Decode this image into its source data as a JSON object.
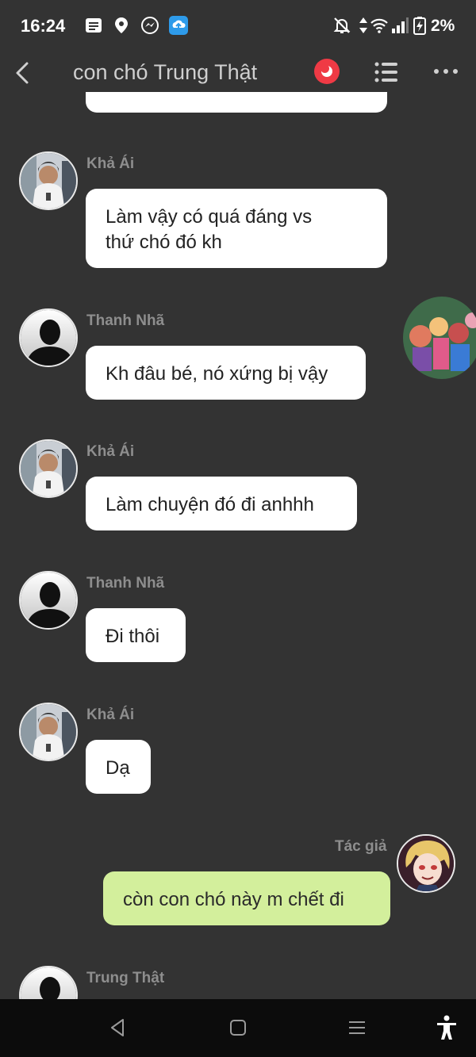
{
  "status": {
    "time": "16:24",
    "battery": "2%"
  },
  "header": {
    "title": "con chó Trung Thật"
  },
  "messages": [
    {
      "sender": "Khả Ái",
      "text": "Làm vậy có quá đáng vs\nthứ chó đó kh"
    },
    {
      "sender": "Thanh Nhã",
      "text": "Kh đâu bé, nó xứng bị vậy"
    },
    {
      "sender": "Khả Ái",
      "text": "Làm chuyện đó đi anhhh"
    },
    {
      "sender": "Thanh Nhã",
      "text": "Đi thôi"
    },
    {
      "sender": "Khả Ái",
      "text": "Dạ"
    },
    {
      "sender": "Tác giả",
      "text": "còn con chó này m chết đi"
    },
    {
      "sender": "Trung Thật",
      "text": ""
    }
  ],
  "colors": {
    "background": "#333333",
    "incoming_bubble": "#ffffff",
    "outgoing_bubble": "#d3ef9c",
    "record_button": "#ef3a45",
    "nav_bar": "#0c0c0c"
  }
}
